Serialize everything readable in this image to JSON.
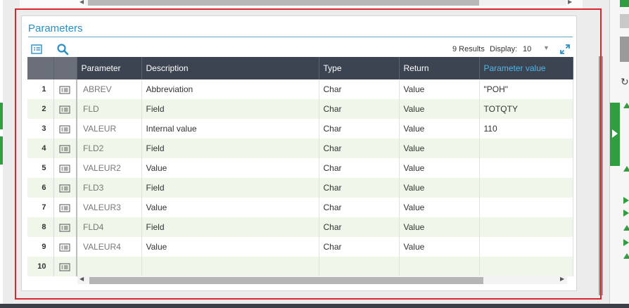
{
  "section": {
    "title": "Parameters"
  },
  "toolbar": {
    "results_text": "9 Results",
    "display_label": "Display:",
    "display_value": "10"
  },
  "grid": {
    "columns": [
      {
        "label": ""
      },
      {
        "label": ""
      },
      {
        "label": "Parameter"
      },
      {
        "label": "Description"
      },
      {
        "label": "Type"
      },
      {
        "label": "Return"
      },
      {
        "label": "Parameter value"
      }
    ],
    "rows": [
      {
        "num": "1",
        "parameter": "ABREV",
        "description": "Abbreviation",
        "type": "Char",
        "return": "Value",
        "value": "\"POH\""
      },
      {
        "num": "2",
        "parameter": "FLD",
        "description": "Field",
        "type": "Char",
        "return": "Value",
        "value": "TOTQTY"
      },
      {
        "num": "3",
        "parameter": "VALEUR",
        "description": "Internal value",
        "type": "Char",
        "return": "Value",
        "value": "110"
      },
      {
        "num": "4",
        "parameter": "FLD2",
        "description": "Field",
        "type": "Char",
        "return": "Value",
        "value": ""
      },
      {
        "num": "5",
        "parameter": "VALEUR2",
        "description": "Value",
        "type": "Char",
        "return": "Value",
        "value": ""
      },
      {
        "num": "6",
        "parameter": "FLD3",
        "description": "Field",
        "type": "Char",
        "return": "Value",
        "value": ""
      },
      {
        "num": "7",
        "parameter": "VALEUR3",
        "description": "Value",
        "type": "Char",
        "return": "Value",
        "value": ""
      },
      {
        "num": "8",
        "parameter": "FLD4",
        "description": "Field",
        "type": "Char",
        "return": "Value",
        "value": ""
      },
      {
        "num": "9",
        "parameter": "VALEUR4",
        "description": "Value",
        "type": "Char",
        "return": "Value",
        "value": ""
      },
      {
        "num": "10",
        "parameter": "",
        "description": "",
        "type": "",
        "return": "",
        "value": ""
      }
    ]
  },
  "icons": {
    "list": "list-view-icon",
    "search": "search-icon",
    "expand": "expand-icon",
    "row_detail": "row-detail-icon",
    "refresh": "refresh-icon"
  },
  "colors": {
    "accent": "#2a8fc7",
    "header_bg": "#3d4451",
    "active_header_text": "#4cb7ea",
    "stripe": "#eff7ea",
    "highlight_border": "#d9262f",
    "green": "#2e9e3e"
  }
}
